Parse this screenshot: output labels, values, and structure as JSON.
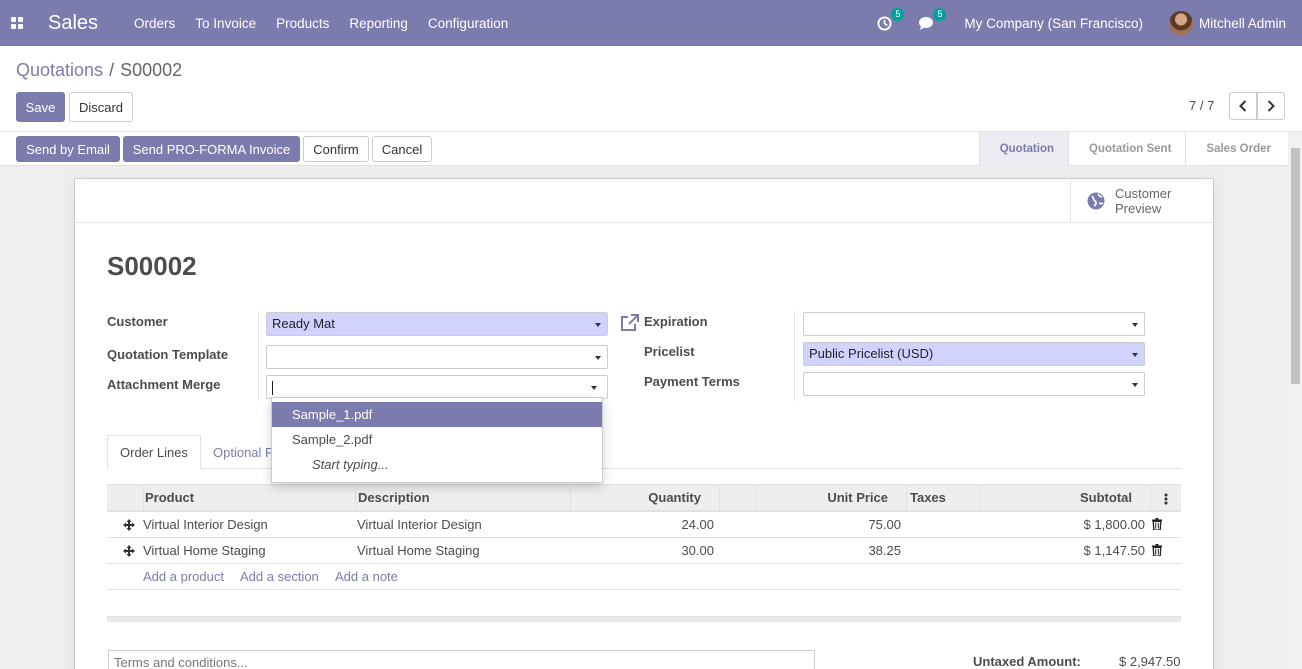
{
  "navbar": {
    "app_name": "Sales",
    "menu": [
      "Orders",
      "To Invoice",
      "Products",
      "Reporting",
      "Configuration"
    ],
    "activity_count": "5",
    "messages_count": "5",
    "company": "My Company (San Francisco)",
    "user": "Mitchell Admin"
  },
  "breadcrumb": {
    "parent": "Quotations",
    "separator": "/",
    "current": "S00002"
  },
  "control": {
    "save": "Save",
    "discard": "Discard",
    "pager": "7 / 7"
  },
  "actions": {
    "send_email": "Send by Email",
    "send_proforma": "Send PRO-FORMA Invoice",
    "confirm": "Confirm",
    "cancel": "Cancel"
  },
  "stages": [
    "Quotation",
    "Quotation Sent",
    "Sales Order"
  ],
  "preview": {
    "line1": "Customer",
    "line2": "Preview"
  },
  "record": {
    "name": "S00002"
  },
  "fields": {
    "customer_label": "Customer",
    "customer_value": "Ready Mat",
    "template_label": "Quotation Template",
    "template_value": "",
    "attachment_label": "Attachment Merge",
    "attachment_value": "",
    "expiration_label": "Expiration",
    "expiration_value": "",
    "pricelist_label": "Pricelist",
    "pricelist_value": "Public Pricelist (USD)",
    "payment_label": "Payment Terms",
    "payment_value": ""
  },
  "dropdown": {
    "items": [
      "Sample_1.pdf",
      "Sample_2.pdf"
    ],
    "typing": "Start typing..."
  },
  "tabs": [
    "Order Lines",
    "Optional P"
  ],
  "table": {
    "headers": {
      "product": "Product",
      "description": "Description",
      "quantity": "Quantity",
      "unit_price": "Unit Price",
      "taxes": "Taxes",
      "subtotal": "Subtotal"
    },
    "rows": [
      {
        "product": "Virtual Interior Design",
        "description": "Virtual Interior Design",
        "quantity": "24.00",
        "unit_price": "75.00",
        "taxes": "",
        "subtotal": "$ 1,800.00"
      },
      {
        "product": "Virtual Home Staging",
        "description": "Virtual Home Staging",
        "quantity": "30.00",
        "unit_price": "38.25",
        "taxes": "",
        "subtotal": "$ 1,147.50"
      }
    ],
    "add_product": "Add a product",
    "add_section": "Add a section",
    "add_note": "Add a note"
  },
  "footer": {
    "terms_placeholder": "Terms and conditions...",
    "untaxed_label": "Untaxed Amount:",
    "untaxed_value": "$ 2,947.50"
  },
  "colors": {
    "primary": "#7c7bad",
    "required_field": "#d2d2ff"
  }
}
